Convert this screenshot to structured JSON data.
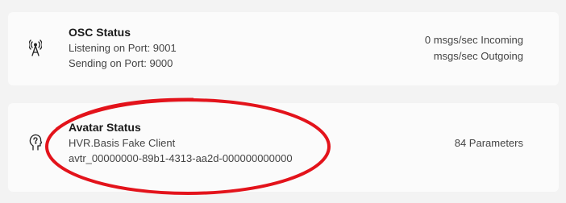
{
  "osc": {
    "title": "OSC Status",
    "listening": "Listening on Port: 9001",
    "sending": "Sending on Port: 9000",
    "incoming": "0 msgs/sec Incoming",
    "outgoing": "msgs/sec Outgoing",
    "icon": "antenna-icon"
  },
  "avatar": {
    "title": "Avatar Status",
    "client": "HVR.Basis Fake Client",
    "avatar_id": "avtr_00000000-89b1-4313-aa2d-000000000000",
    "parameters": "84 Parameters",
    "icon": "avatar-head-icon"
  },
  "annotation": {
    "color": "#e3131b"
  }
}
